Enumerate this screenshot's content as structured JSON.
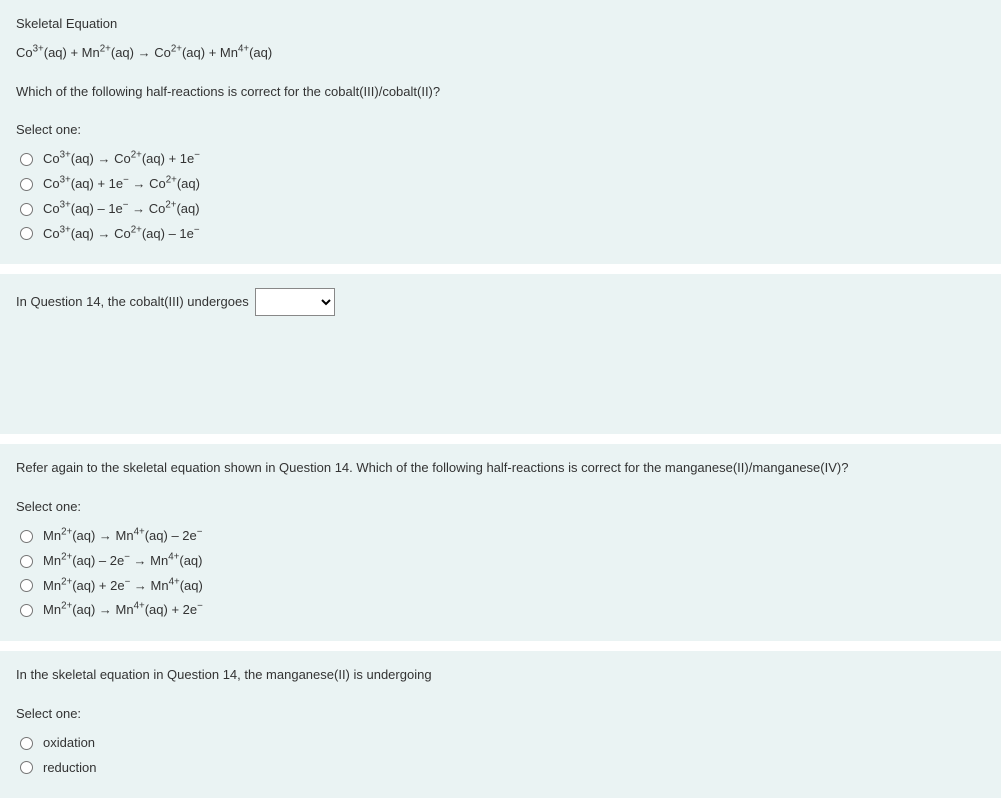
{
  "q1": {
    "header": "Skeletal Equation",
    "equation": "Co³⁺(aq) + Mn²⁺(aq) → Co²⁺(aq) + Mn⁴⁺(aq)",
    "prompt": "Which of the following half-reactions is correct for the cobalt(III)/cobalt(II)?",
    "select_label": "Select one:",
    "options": [
      "Co³⁺(aq) → Co²⁺(aq) + 1e⁻",
      "Co³⁺(aq) + 1e⁻ → Co²⁺(aq)",
      "Co³⁺(aq) – 1e⁻ → Co²⁺(aq)",
      "Co³⁺(aq) → Co²⁺(aq) – 1e⁻"
    ]
  },
  "q2": {
    "prompt_prefix": "In Question 14, the cobalt(III) undergoes",
    "dropdown_value": ""
  },
  "q3": {
    "prompt": "Refer again to the skeletal equation shown in Question 14. Which of the following half-reactions is correct for the manganese(II)/manganese(IV)?",
    "select_label": "Select one:",
    "options": [
      "Mn²⁺(aq) → Mn⁴⁺(aq) – 2e⁻",
      "Mn²⁺(aq) – 2e⁻ → Mn⁴⁺(aq)",
      "Mn²⁺(aq) + 2e⁻ → Mn⁴⁺(aq)",
      "Mn²⁺(aq) → Mn⁴⁺(aq) + 2e⁻"
    ]
  },
  "q4": {
    "prompt": "In the skeletal equation in Question 14, the manganese(II) is undergoing",
    "select_label": "Select one:",
    "options": [
      "oxidation",
      "reduction"
    ]
  }
}
